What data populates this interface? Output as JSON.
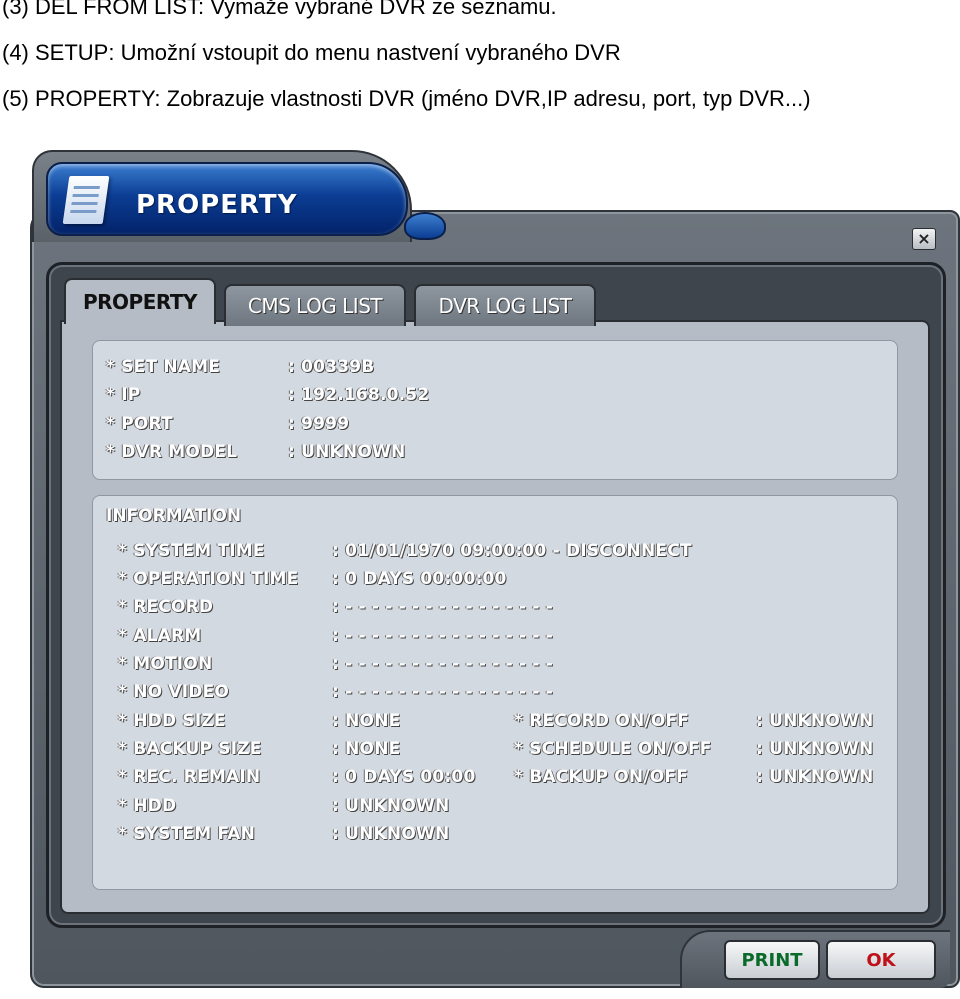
{
  "doc_text": {
    "line1": "(3) DEL FROM LIST: Vymaže vybrané DVR ze seznamu.",
    "line2": "(4) SETUP: Umožní vstoupit do menu nastvení vybraného DVR",
    "line3": "(5) PROPERTY: Zobrazuje vlastnosti DVR (jméno DVR,IP adresu, port, typ DVR...)"
  },
  "window": {
    "title": "PROPERTY",
    "close_label": "×"
  },
  "tabs": [
    {
      "label": "PROPERTY",
      "active": true
    },
    {
      "label": "CMS LOG LIST",
      "active": false
    },
    {
      "label": "DVR LOG LIST",
      "active": false
    }
  ],
  "property": {
    "rows": [
      {
        "label": "* SET NAME",
        "value": ": 00339B"
      },
      {
        "label": "* IP",
        "value": ": 192.168.0.52"
      },
      {
        "label": "* PORT",
        "value": ": 9999"
      },
      {
        "label": "* DVR MODEL",
        "value": ": UNKNOWN"
      }
    ]
  },
  "information": {
    "heading": "INFORMATION",
    "rows": [
      {
        "label": "* SYSTEM TIME",
        "value": ": 01/01/1970 09:00:00  - DISCONNECT"
      },
      {
        "label": "* OPERATION TIME",
        "value": ": 0 DAYS 00:00:00"
      },
      {
        "label": "* RECORD",
        "value": ": -  -  -  -    -  -  -  -    -  -  -  -    -  -  -  -"
      },
      {
        "label": "* ALARM",
        "value": ": -  -  -  -    -  -  -  -    -  -  -  -    -  -  -  -"
      },
      {
        "label": "* MOTION",
        "value": ": -  -  -  -    -  -  -  -    -  -  -  -    -  -  -  -"
      },
      {
        "label": "* NO VIDEO",
        "value": ": -  -  -  -    -  -  -  -    -  -  -  -    -  -  -  -"
      },
      {
        "label": "* HDD SIZE",
        "value": ": NONE"
      },
      {
        "label": "* BACKUP SIZE",
        "value": ": NONE"
      },
      {
        "label": "* REC. REMAIN",
        "value": ": 0 DAYS 00:00"
      },
      {
        "label": "* HDD",
        "value": ": UNKNOWN"
      },
      {
        "label": "* SYSTEM FAN",
        "value": ": UNKNOWN"
      }
    ],
    "right_rows": [
      {
        "label": "* RECORD ON/OFF",
        "value": ": UNKNOWN"
      },
      {
        "label": "* SCHEDULE ON/OFF",
        "value": ": UNKNOWN"
      },
      {
        "label": "* BACKUP ON/OFF",
        "value": ": UNKNOWN"
      }
    ]
  },
  "buttons": {
    "print": "PRINT",
    "ok": "OK"
  },
  "colors": {
    "title_blue": "#0b3d93",
    "print_green": "#0a6a2a",
    "ok_red": "#c0101a"
  }
}
